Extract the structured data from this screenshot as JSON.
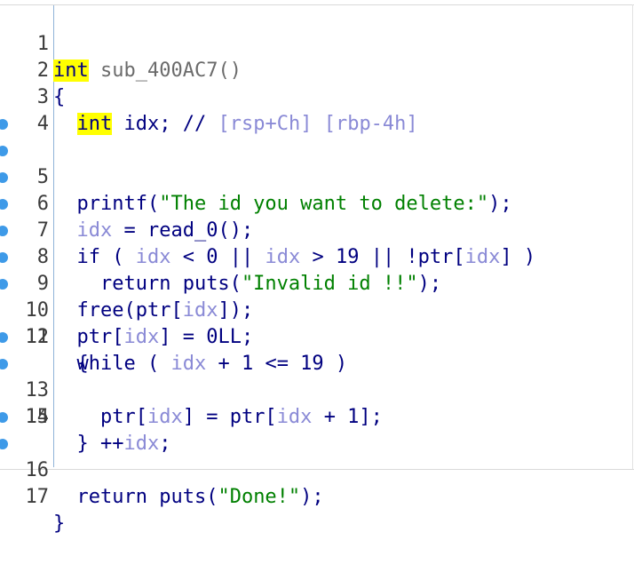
{
  "lines": [
    {
      "num": "1",
      "bp": false
    },
    {
      "num": "2",
      "bp": false
    },
    {
      "num": "3",
      "bp": false
    },
    {
      "num": "4",
      "bp": false
    },
    {
      "num": "5",
      "bp": true
    },
    {
      "num": "6",
      "bp": true
    },
    {
      "num": "7",
      "bp": true
    },
    {
      "num": "8",
      "bp": true
    },
    {
      "num": "9",
      "bp": true
    },
    {
      "num": "10",
      "bp": true
    },
    {
      "num": "11",
      "bp": true
    },
    {
      "num": "12",
      "bp": false
    },
    {
      "num": "13",
      "bp": true
    },
    {
      "num": "14",
      "bp": true
    },
    {
      "num": "15",
      "bp": false
    },
    {
      "num": "16",
      "bp": true
    },
    {
      "num": "17",
      "bp": true
    }
  ],
  "tokens": {
    "int": "int",
    "fn_name": "sub_400AC7()",
    "open_brace": "{",
    "close_brace": "}",
    "idx": "idx",
    "decl_rest": "; //",
    "rsp": "[rsp+Ch]",
    "rbp": "[rbp-4h]",
    "printf": "printf(",
    "printf_str": "\"The id you want to delete:\"",
    "close_paren_semi": ");",
    "assign": "=",
    "read0": "read_0();",
    "if_open": "if (",
    "lt0": "< 0 ||",
    "gt19": "> 19 || !ptr[",
    "bracket_close_paren": "] )",
    "return_puts": "return puts(",
    "invalid_str": "\"Invalid id !!\"",
    "free": "free(ptr[",
    "close_bracket_paren_semi": "]);",
    "ptr_open": "ptr[",
    "assign_0ll": "] = 0LL;",
    "while_open": "while (",
    "plus1_le19": "+ 1 <= 19 )",
    "assign_ptr_open": "] = ptr[",
    "plus1_close": "+ 1];",
    "incr": "++",
    "semi": ";",
    "done_str": "\"Done!\""
  }
}
